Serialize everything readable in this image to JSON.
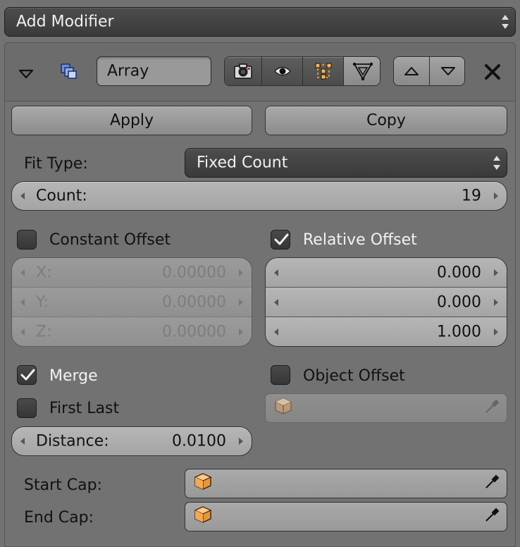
{
  "add_modifier": {
    "label": "Add Modifier"
  },
  "modifier": {
    "name": "Array",
    "header_icons": [
      "collapse-triangle-icon",
      "array-modifier-icon",
      "render-camera-icon",
      "visibility-eye-icon",
      "editmode-vertices-icon",
      "cage-triangle-icon",
      "move-up-icon",
      "move-down-icon",
      "remove-x-icon"
    ],
    "apply_label": "Apply",
    "copy_label": "Copy",
    "fit_type": {
      "label": "Fit Type:",
      "value": "Fixed Count"
    },
    "count": {
      "label": "Count:",
      "value": "19"
    },
    "constant_offset": {
      "label": "Constant Offset",
      "checked": false,
      "x": {
        "label": "X:",
        "value": "0.00000"
      },
      "y": {
        "label": "Y:",
        "value": "0.00000"
      },
      "z": {
        "label": "Z:",
        "value": "0.00000"
      }
    },
    "relative_offset": {
      "label": "Relative Offset",
      "checked": true,
      "x": "0.000",
      "y": "0.000",
      "z": "1.000"
    },
    "merge": {
      "label": "Merge",
      "checked": true
    },
    "first_last": {
      "label": "First Last",
      "checked": false
    },
    "distance": {
      "label": "Distance:",
      "value": "0.0100"
    },
    "object_offset": {
      "label": "Object Offset",
      "checked": false
    },
    "start_cap": {
      "label": "Start Cap:"
    },
    "end_cap": {
      "label": "End Cap:"
    }
  },
  "colors": {
    "panel_bg": "#727272",
    "cube_orange": "#e8943a"
  }
}
